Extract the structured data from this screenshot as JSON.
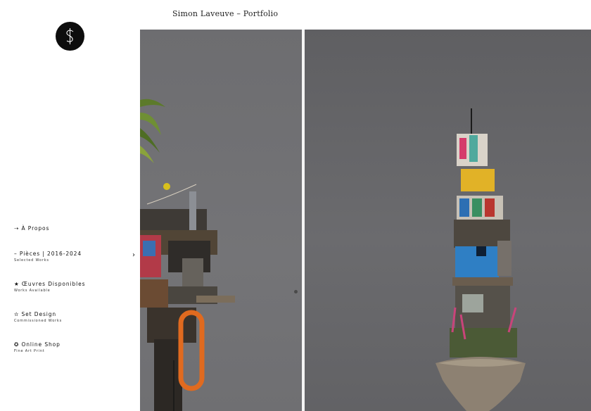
{
  "header": {
    "title": "Simon Laveuve – Portfolio"
  },
  "logo": {
    "icon": "dollar-monogram-icon"
  },
  "nav": {
    "items": [
      {
        "label": "⇢ À Propos",
        "sub": ""
      },
      {
        "label": "– Pièces | 2016-2024",
        "sub": "Selected Works",
        "chevron": "›"
      },
      {
        "label": "★ Œuvres Disponibles",
        "sub": "Works Available"
      },
      {
        "label": "✫ Set Design",
        "sub": "Commissioned Works"
      },
      {
        "label": "✪ Online Shop",
        "sub": "Fine Art Print"
      }
    ]
  },
  "gallery": {
    "images": [
      {
        "name": "sculpture-left"
      },
      {
        "name": "sculpture-right"
      }
    ],
    "colors": {
      "background_left": "#727275",
      "background_right": "#67676a",
      "divider": "#f4f4f4"
    }
  }
}
